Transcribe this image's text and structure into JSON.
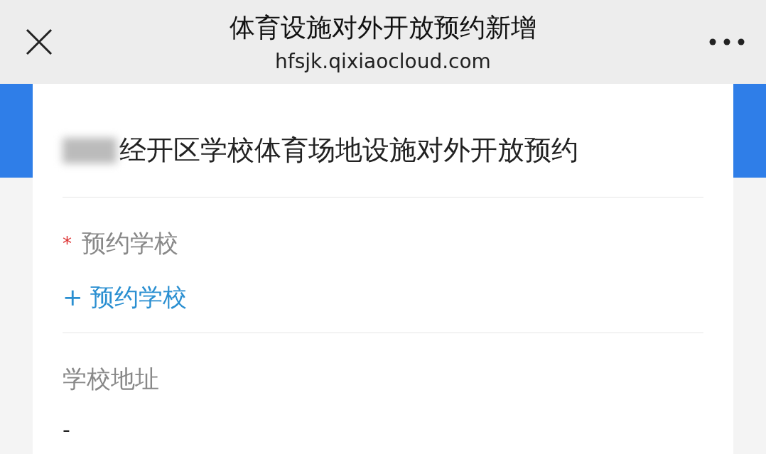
{
  "header": {
    "title": "体育设施对外开放预约新增",
    "url": "hfsjk.qixiaocloud.com"
  },
  "form": {
    "title": "经开区学校体育场地设施对外开放预约",
    "fields": [
      {
        "kind": "picker",
        "label": "预约学校",
        "required_mark": "*",
        "action": "+ 预约学校"
      },
      {
        "kind": "text",
        "label": "学校地址",
        "value": "-"
      }
    ]
  }
}
